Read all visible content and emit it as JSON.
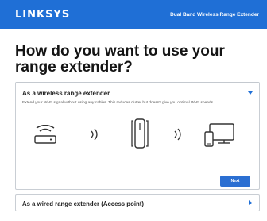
{
  "header": {
    "brand": "LINKSYS",
    "product": "Dual Band Wireless Range Extender"
  },
  "headline": "How do you want to use your range extender?",
  "options": [
    {
      "title": "As a wireless range extender",
      "description": "Extend your Wi-Fi signal without using any cables. This reduces clutter but doesn't give you optimal Wi-Fi speeds.",
      "button_label": "Next",
      "expanded": true,
      "icons": [
        "router-icon",
        "wifi-signal-icon",
        "range-extender-icon",
        "wifi-signal-icon",
        "devices-icon"
      ]
    },
    {
      "title": "As a wired range extender (Access point)",
      "expanded": false
    }
  ],
  "colors": {
    "accent": "#1f6fd6",
    "button": "#2b6fd2",
    "border": "#c9ced4"
  }
}
